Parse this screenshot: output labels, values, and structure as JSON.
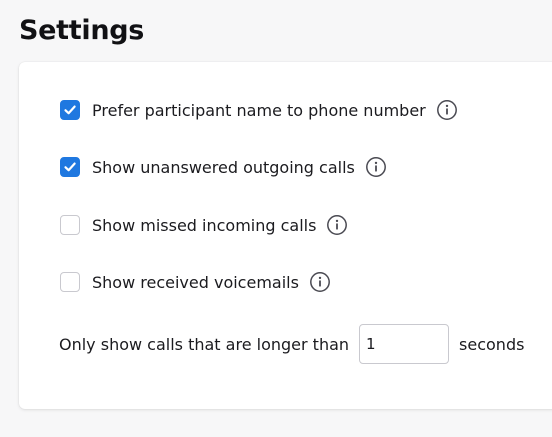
{
  "page": {
    "title": "Settings"
  },
  "settings": {
    "options": [
      {
        "label": "Prefer participant name to phone number",
        "checked": true
      },
      {
        "label": "Show unanswered outgoing calls",
        "checked": true
      },
      {
        "label": "Show missed incoming calls",
        "checked": false
      },
      {
        "label": "Show received voicemails",
        "checked": false
      }
    ],
    "duration": {
      "prefix": "Only show calls that are longer than",
      "value": "1",
      "unit": "seconds"
    }
  },
  "colors": {
    "accent": "#1f78e0",
    "background": "#f7f7f8",
    "card": "#ffffff"
  },
  "icons": {
    "checkbox_mark": "checkmark-icon",
    "info": "info-icon"
  }
}
